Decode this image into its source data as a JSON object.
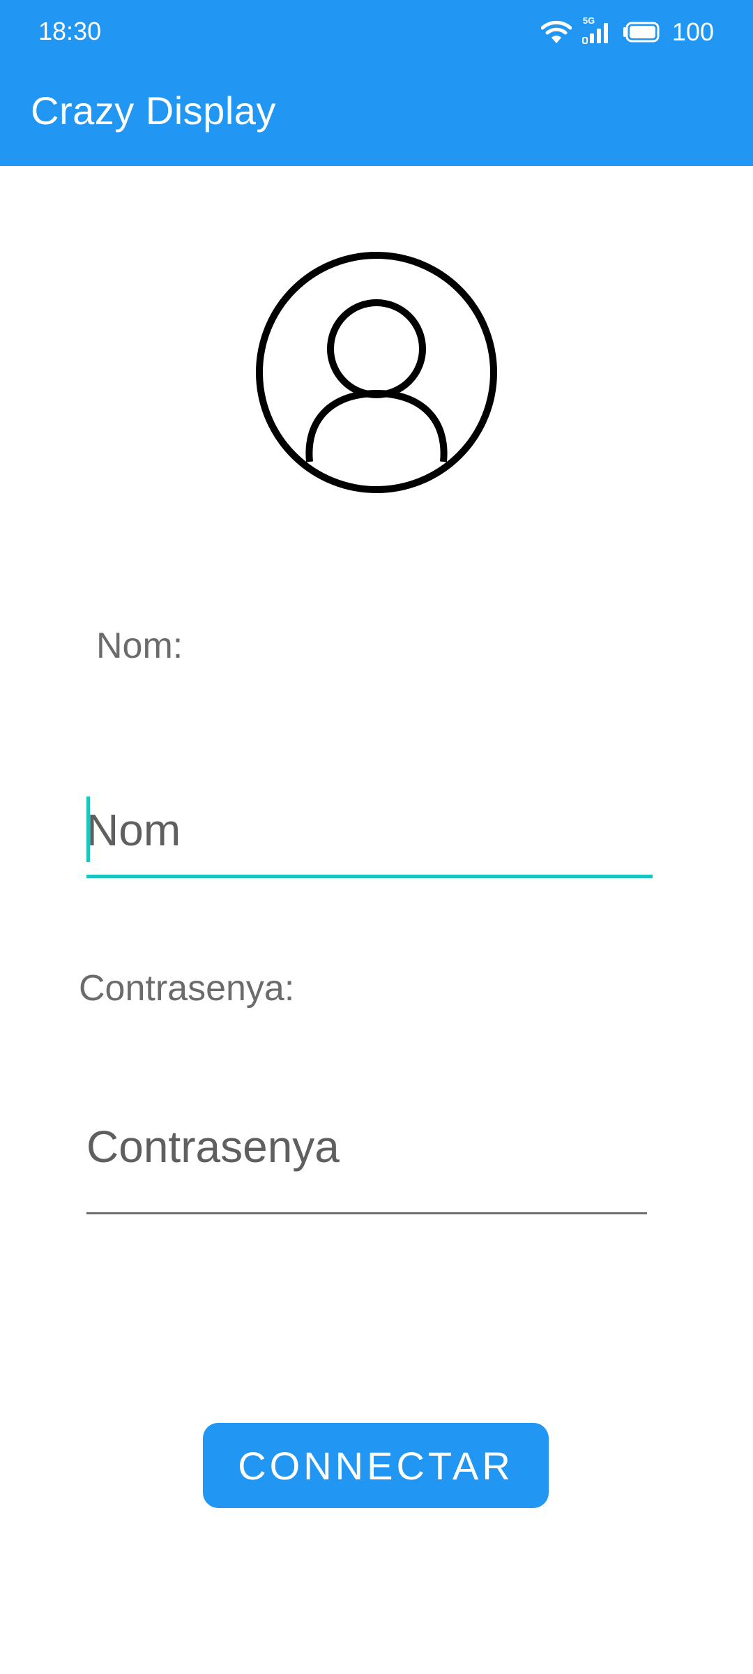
{
  "status_bar": {
    "time": "18:30",
    "network_label": "5G",
    "battery": "100"
  },
  "app_bar": {
    "title": "Crazy Display"
  },
  "form": {
    "name_label": "Nom:",
    "name_placeholder": "Nom",
    "name_value": "",
    "password_label": "Contrasenya:",
    "password_placeholder": "Contrasenya",
    "password_value": "",
    "connect_button": "CONNECTAR"
  },
  "colors": {
    "primary": "#2196F3",
    "focus_accent": "#1CC6C0",
    "label_text": "#6b6b6b"
  },
  "icons": {
    "avatar": "user-circle-icon",
    "wifi": "wifi-icon",
    "signal": "signal-icon",
    "battery": "battery-icon"
  }
}
